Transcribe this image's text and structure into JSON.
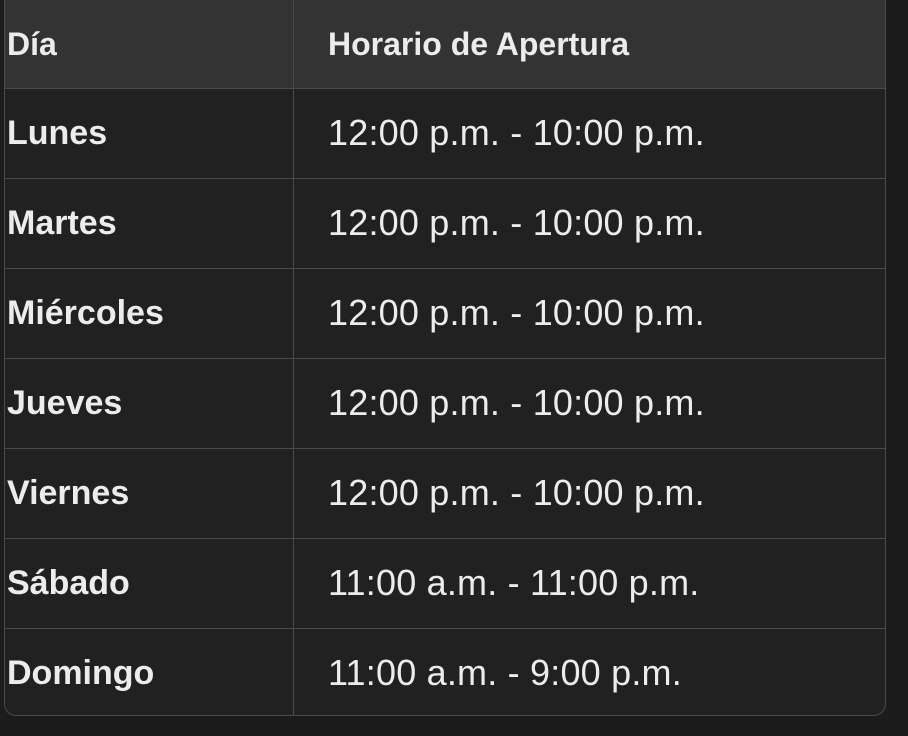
{
  "table": {
    "headers": [
      "Día",
      "Horario de Apertura"
    ],
    "rows": [
      {
        "day": "Lunes",
        "hours": "12:00 p.m. - 10:00 p.m."
      },
      {
        "day": "Martes",
        "hours": "12:00 p.m. - 10:00 p.m."
      },
      {
        "day": "Miércoles",
        "hours": "12:00 p.m. - 10:00 p.m."
      },
      {
        "day": "Jueves",
        "hours": "12:00 p.m. - 10:00 p.m."
      },
      {
        "day": "Viernes",
        "hours": "12:00 p.m. - 10:00 p.m."
      },
      {
        "day": "Sábado",
        "hours": "11:00 a.m. - 11:00 p.m."
      },
      {
        "day": "Domingo",
        "hours": "11:00 a.m. - 9:00 p.m."
      }
    ]
  },
  "colors": {
    "background": "#1c1c1c",
    "table_body": "#212121",
    "header_bg": "#333333",
    "border": "#4a4a4a",
    "text": "#ececec"
  }
}
